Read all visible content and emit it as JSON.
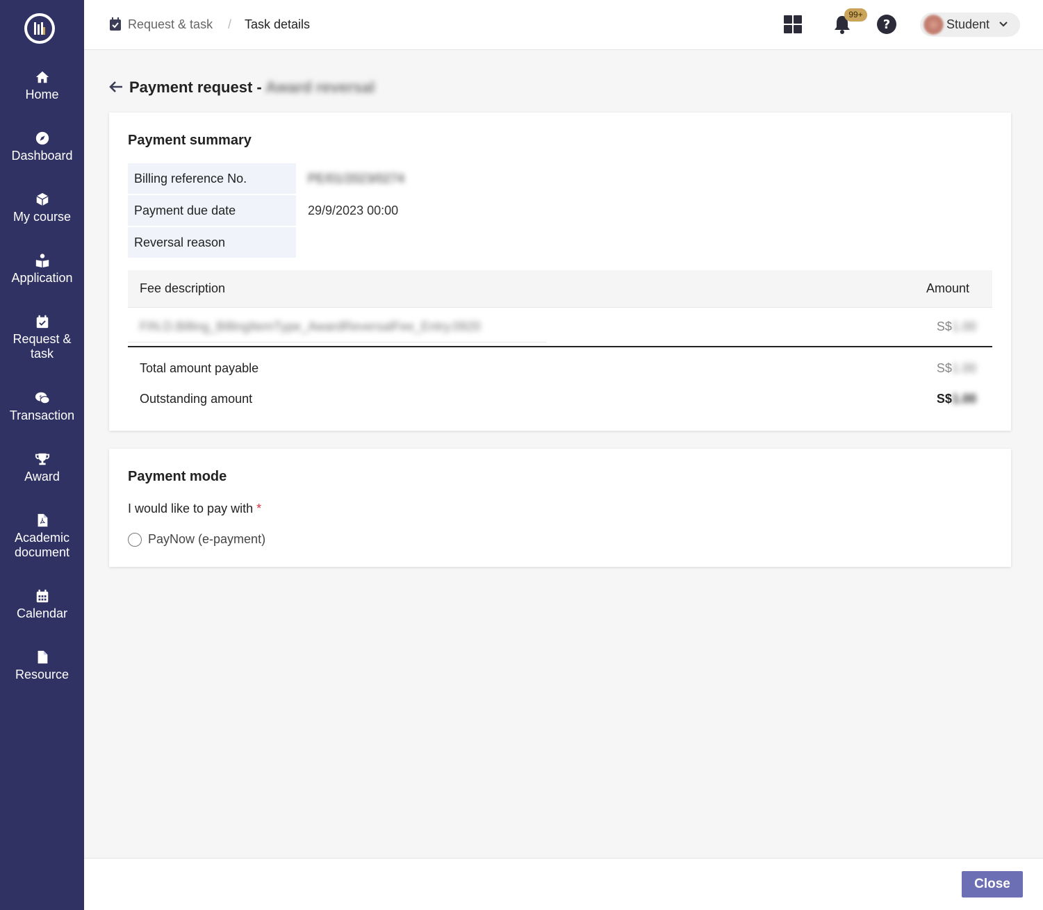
{
  "sidebar": {
    "items": [
      {
        "label": "Home",
        "icon": "home-icon"
      },
      {
        "label": "Dashboard",
        "icon": "compass-icon"
      },
      {
        "label": "My course",
        "icon": "box-icon"
      },
      {
        "label": "Application",
        "icon": "reader-icon"
      },
      {
        "label": "Request &\ntask",
        "icon": "calendar-check-icon"
      },
      {
        "label": "Transaction",
        "icon": "chat-dollar-icon"
      },
      {
        "label": "Award",
        "icon": "trophy-icon"
      },
      {
        "label": "Academic\ndocument",
        "icon": "pdf-file-icon"
      },
      {
        "label": "Calendar",
        "icon": "calendar-icon"
      },
      {
        "label": "Resource",
        "icon": "file-icon"
      }
    ]
  },
  "header": {
    "breadcrumb": {
      "parent": "Request & task",
      "separator": "/",
      "current": "Task details"
    },
    "notification_badge": "99+",
    "user": {
      "name": "Student"
    }
  },
  "page": {
    "title": "Payment request - ",
    "title_suffix_redacted": "Award reversal"
  },
  "summary": {
    "title": "Payment summary",
    "rows": [
      {
        "label": "Billing reference No.",
        "value": "PE/01/2023/0274"
      },
      {
        "label": "Payment due date",
        "value": "29/9/2023 00:00"
      },
      {
        "label": "Reversal reason",
        "value": ""
      }
    ],
    "table": {
      "col_desc": "Fee description",
      "col_amount": "Amount",
      "row_desc": "FIN.D.Billing_BillingItemType_AwardReversalFee_Entry.0920",
      "row_amount_prefix": "S$",
      "row_amount_redacted": "1.00"
    },
    "total_label": "Total amount payable",
    "total_prefix": "S$",
    "total_redacted": "1.00",
    "outstanding_label": "Outstanding amount",
    "outstanding_prefix": "S$",
    "outstanding_redacted": "1.00"
  },
  "payment_mode": {
    "title": "Payment mode",
    "prompt": "I would like to pay with",
    "required_mark": "*",
    "options": [
      {
        "label": "PayNow (e-payment)"
      }
    ]
  },
  "footer": {
    "close_label": "Close"
  },
  "colors": {
    "sidebar": "#2f3263",
    "accent_button": "#6c6fb3",
    "badge": "#c9a45a",
    "required": "#d9363e"
  }
}
